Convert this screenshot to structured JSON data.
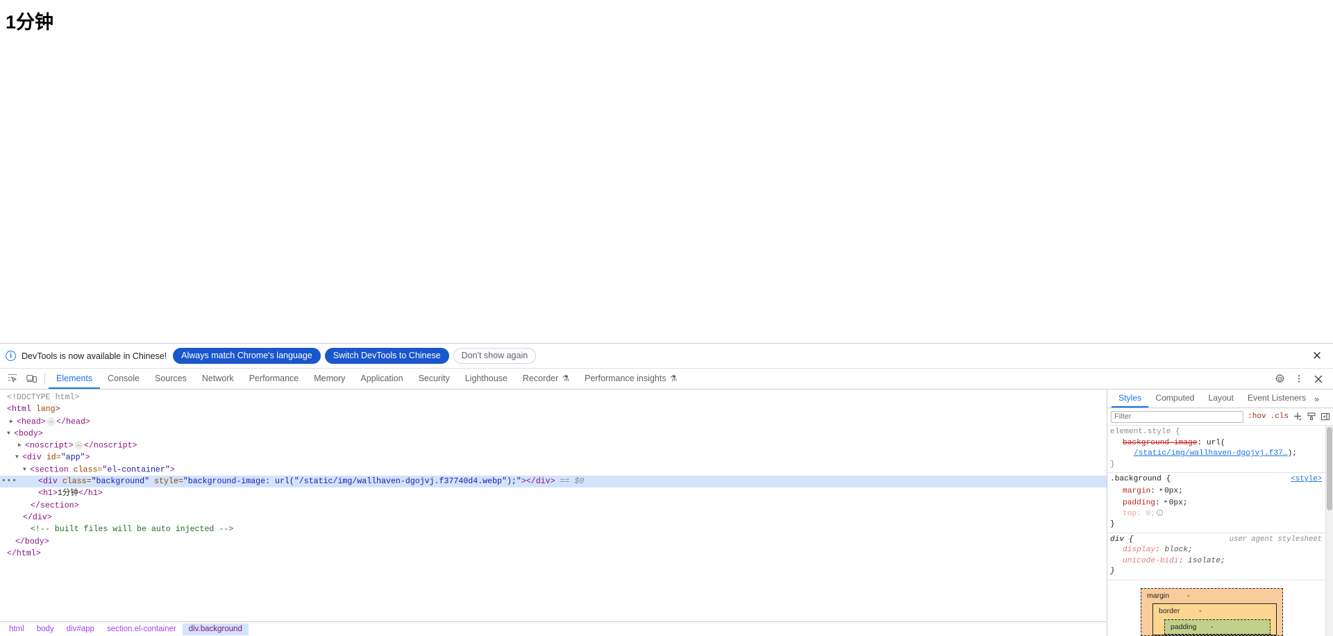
{
  "page": {
    "heading": "1分钟"
  },
  "infobar": {
    "icon": "info-circle-icon",
    "message": "DevTools is now available in Chinese!",
    "primary_button": "Always match Chrome's language",
    "secondary_button": "Switch DevTools to Chinese",
    "dismiss_button": "Don't show again",
    "close_icon": "✕",
    "accent_color": "#1a56cc"
  },
  "tabstrip": {
    "inspect_icon": "inspect-cursor-icon",
    "device_icon": "device-toolbar-icon",
    "tabs": [
      {
        "label": "Elements",
        "selected": true,
        "flask": ""
      },
      {
        "label": "Console",
        "selected": false,
        "flask": ""
      },
      {
        "label": "Sources",
        "selected": false,
        "flask": ""
      },
      {
        "label": "Network",
        "selected": false,
        "flask": ""
      },
      {
        "label": "Performance",
        "selected": false,
        "flask": ""
      },
      {
        "label": "Memory",
        "selected": false,
        "flask": ""
      },
      {
        "label": "Application",
        "selected": false,
        "flask": ""
      },
      {
        "label": "Security",
        "selected": false,
        "flask": ""
      },
      {
        "label": "Lighthouse",
        "selected": false,
        "flask": ""
      },
      {
        "label": "Recorder",
        "selected": false,
        "flask": "⚗"
      },
      {
        "label": "Performance insights",
        "selected": false,
        "flask": "⚗"
      }
    ],
    "settings_icon": "gear-icon",
    "more_icon": "kebab-menu-icon",
    "close_icon": "close-icon"
  },
  "dom_tree": {
    "rows": [
      {
        "indent": 0,
        "doctype": "<!DOCTYPE html>"
      },
      {
        "indent": 0,
        "open": "<html",
        "attr_name": "lang",
        "close": ">"
      },
      {
        "indent": 0,
        "twisty": "▶",
        "open": "<head>",
        "ellipsis": "…",
        "end": "</head>"
      },
      {
        "indent": 0,
        "twisty": "▼",
        "open": "<body>"
      },
      {
        "indent": 1,
        "twisty": "▶",
        "open": "<noscript>",
        "ellipsis": "…",
        "end": "</noscript>"
      },
      {
        "indent": 1,
        "twisty": "▼",
        "open": "<div",
        "attr_name": "id",
        "attr_value": "\"app\"",
        "close": ">"
      },
      {
        "indent": 2,
        "twisty": "▼",
        "open": "<section",
        "attr_name": "class",
        "attr_value": "\"el-container\"",
        "close": ">"
      },
      {
        "indent": 3,
        "selected": true,
        "gutter": "•••",
        "open": "<div",
        "attr1_name": "class",
        "attr1_value": "\"background\"",
        "attr2_name": "style",
        "attr2_value": "\"background-image: url(\"/static/img/wallhaven-dgojvj.f37740d4.webp\");\"",
        "close": ">",
        "end": "</div>",
        "marker": "== $0"
      },
      {
        "indent": 3,
        "open": "<h1>",
        "text": "1分钟",
        "end": "</h1>"
      },
      {
        "indent": 2,
        "end": "</section>"
      },
      {
        "indent": 1,
        "end": "</div>"
      },
      {
        "indent": 1,
        "comment": "<!-- built files will be auto injected -->"
      },
      {
        "indent": 0,
        "end": "</body>"
      },
      {
        "indent": 0,
        "end": "</html>"
      }
    ]
  },
  "breadcrumb": {
    "items": [
      {
        "label": "html",
        "selected": false
      },
      {
        "label": "body",
        "selected": false
      },
      {
        "label": "div#app",
        "selected": false
      },
      {
        "label": "section.el-container",
        "selected": false
      },
      {
        "label": "div.background",
        "selected": true
      }
    ]
  },
  "styles": {
    "tabs": [
      {
        "label": "Styles",
        "selected": true
      },
      {
        "label": "Computed",
        "selected": false
      },
      {
        "label": "Layout",
        "selected": false
      },
      {
        "label": "Event Listeners",
        "selected": false
      }
    ],
    "more_tabs_icon": "»",
    "filter_placeholder": "Filter",
    "hov_button": ":hov",
    "cls_button": ".cls",
    "new_rule_icon": "plus-icon",
    "class_icon": "style-paint-icon",
    "sidebar_icon": "toggle-sidebar-icon",
    "rules": [
      {
        "selector": "element.style",
        "origin": "",
        "declarations": [
          {
            "name": "background-image",
            "value": "url(",
            "link": "/static/img/wallhaven-dgojvj.f37…",
            "value_tail": ");"
          }
        ]
      },
      {
        "selector": ".background",
        "origin": "<style>",
        "origin_is_link": true,
        "declarations": [
          {
            "name": "margin",
            "value": "0px;",
            "expandable": true
          },
          {
            "name": "padding",
            "value": "0px;",
            "expandable": true
          },
          {
            "name": "top",
            "value": "0;",
            "dim": true,
            "info": true
          }
        ]
      },
      {
        "selector": "div",
        "origin": "user agent stylesheet",
        "ua": true,
        "declarations": [
          {
            "name": "display",
            "value": "block;"
          },
          {
            "name": "unicode-bidi",
            "value": "isolate;"
          }
        ]
      }
    ]
  },
  "box_model": {
    "margin_label": "margin",
    "margin_value": "-",
    "border_label": "border",
    "border_value": "-",
    "padding_label": "padding",
    "padding_value": "-"
  }
}
